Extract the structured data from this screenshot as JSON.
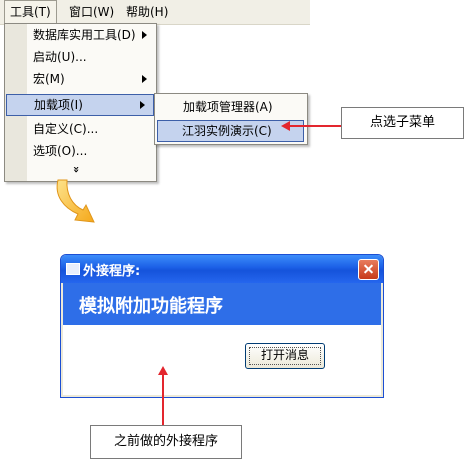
{
  "menubar": {
    "items": [
      {
        "label": "工具(T)"
      },
      {
        "label": "窗口(W)"
      },
      {
        "label": "帮助(H)"
      }
    ]
  },
  "tools_menu": {
    "items": [
      {
        "label": "数据库实用工具(D)",
        "submenu": true
      },
      {
        "label": "启动(U)...",
        "submenu": false
      },
      {
        "label": "宏(M)",
        "submenu": true
      },
      {
        "label": "加载项(I)",
        "submenu": true,
        "highlighted": true
      },
      {
        "label": "自定义(C)...",
        "submenu": false
      },
      {
        "label": "选项(O)...",
        "submenu": false
      }
    ],
    "expand_glyph": "»"
  },
  "addins_submenu": {
    "items": [
      {
        "label": "加载项管理器(A)"
      },
      {
        "label": "江羽实例演示(C)",
        "highlighted": true
      }
    ]
  },
  "callouts": {
    "select_submenu": "点选子菜单",
    "previous_program": "之前做的外接程序"
  },
  "dialog": {
    "title": "外接程序:",
    "banner": "模拟附加功能程序",
    "button_label": "打开消息"
  },
  "colors": {
    "arrow": "#e3262e",
    "highlight": "#c5d3ee",
    "titlebar": "#1b5fe6",
    "yellow_arrow": "#f5b81e"
  },
  "icons": [
    "app-icon",
    "close-icon",
    "submenu-arrow-icon",
    "curved-arrow-icon",
    "expand-icon"
  ]
}
